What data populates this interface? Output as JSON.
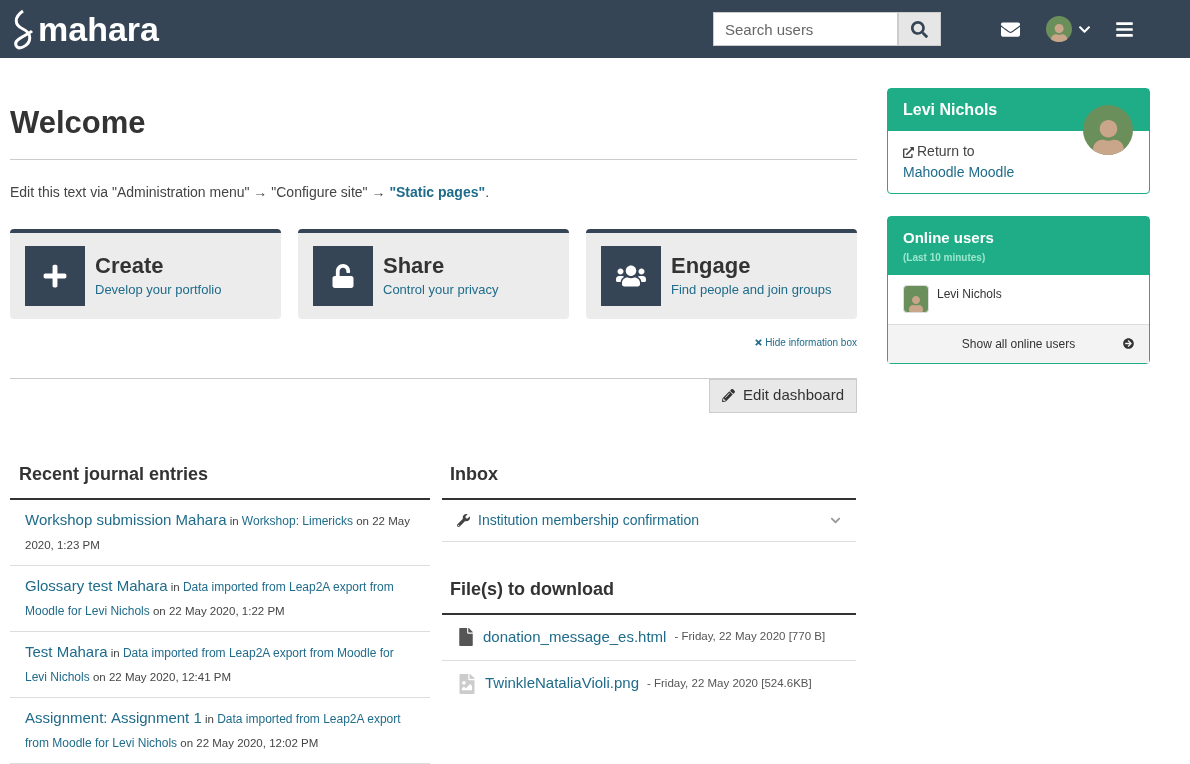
{
  "header": {
    "logo": "mahara",
    "search": {
      "placeholder": "Search users"
    }
  },
  "page_title": "Welcome",
  "intro": {
    "before": "Edit this text via \"Administration menu\" → \"Configure site\" → ",
    "link": "\"Static pages\"",
    "after": "."
  },
  "info_cards": [
    {
      "kind": "create",
      "title": "Create",
      "subtitle": "Develop your portfolio"
    },
    {
      "kind": "share",
      "title": "Share",
      "subtitle": "Control your privacy"
    },
    {
      "kind": "engage",
      "title": "Engage",
      "subtitle": "Find people and join groups"
    }
  ],
  "hide_info_link": "Hide information box",
  "edit_button": "Edit dashboard",
  "journal": {
    "title": "Recent journal entries",
    "entries": [
      {
        "title": "Workshop submission Mahara",
        "connector": "in",
        "blog": "Workshop: Limericks",
        "date": "on 22 May 2020, 1:23 PM"
      },
      {
        "title": "Glossary test Mahara",
        "connector": "in",
        "blog": "Data imported from Leap2A export from Moodle for Levi Nichols",
        "date": "on 22 May 2020, 1:22 PM"
      },
      {
        "title": "Test Mahara",
        "connector": "in",
        "blog": "Data imported from Leap2A export from Moodle for Levi Nichols",
        "date": "on 22 May 2020, 12:41 PM"
      },
      {
        "title": "Assignment: Assignment 1",
        "connector": "in",
        "blog": "Data imported from Leap2A export from Moodle for Levi Nichols",
        "date": "on 22 May 2020, 12:02 PM"
      }
    ]
  },
  "inbox": {
    "title": "Inbox",
    "items": [
      {
        "text": "Institution membership confirmation",
        "expanded": false
      }
    ]
  },
  "files": {
    "title": "File(s) to download",
    "items": [
      {
        "kind": "document",
        "name": "donation_message_es.html",
        "meta": "- Friday, 22 May 2020 [770 B]"
      },
      {
        "kind": "image",
        "name": "TwinkleNataliaVioli.png",
        "meta": "- Friday, 22 May 2020 [524.6KB]"
      }
    ]
  },
  "profile": {
    "name": "Levi Nichols",
    "return_prefix": "Return to",
    "return_link": "Mahoodle Moodle"
  },
  "online_users": {
    "title": "Online users",
    "subtitle": "(Last 10 minutes)",
    "users": [
      {
        "name": "Levi Nichols"
      }
    ],
    "footer": "Show all online users"
  }
}
